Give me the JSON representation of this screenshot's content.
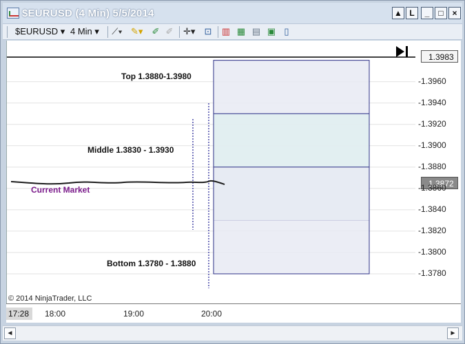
{
  "window": {
    "title": "$EURUSD (4 Min)  5/5/2014",
    "controls": {
      "pin": "▲",
      "link": "L",
      "minimize": "_",
      "maximize": "□",
      "close": "×"
    }
  },
  "toolbar": {
    "instrument": "$EURUSD",
    "interval": "4 Min",
    "icons": [
      "line-drawing-icon",
      "pencil-icon",
      "marker-icon",
      "eraser-icon",
      "crosshair-icon",
      "zoom-icon",
      "bar-type-icon",
      "indicator-icon",
      "strategy-icon",
      "properties-icon",
      "data-box-icon"
    ]
  },
  "chart": {
    "zones": [
      {
        "label": "Top 1.3880-1.3980",
        "low": 1.388,
        "high": 1.398
      },
      {
        "label": "Middle 1.3830 - 1.3930",
        "low": 1.383,
        "high": 1.393
      },
      {
        "label": "Bottom 1.3780 - 1.3880",
        "low": 1.378,
        "high": 1.388
      }
    ],
    "current_market_label": "Current Market",
    "copyright": "© 2014 NinjaTrader, LLC",
    "y_ticks": [
      "1.3960",
      "1.3940",
      "1.3920",
      "1.3900",
      "1.3880",
      "1.3860",
      "1.3840",
      "1.3820",
      "1.3800",
      "1.3780"
    ],
    "price_tags": {
      "top": "1.3983",
      "current": "1.3872"
    },
    "x_ticks": [
      "18:00",
      "19:00",
      "20:00"
    ],
    "start_time": "17:28"
  },
  "colors": {
    "zone_top_fill": "#e8eaf3",
    "zone_overlap_fill": "#e0eef0",
    "zone_border": "#2b2f86",
    "market_label": "#7a1a8a",
    "current_tag": "#8a8a8a"
  },
  "scrollbar": {
    "left": "◄",
    "right": "►"
  }
}
